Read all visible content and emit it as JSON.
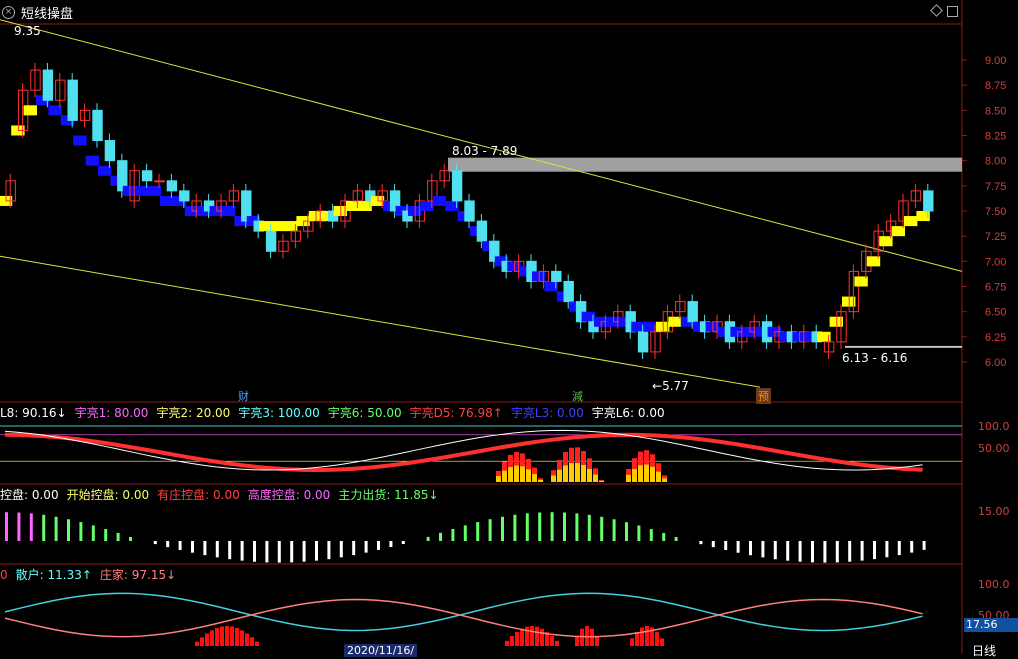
{
  "title": "短线操盘",
  "main_panel": {
    "high_label": "9.35",
    "range_upper_label": "8.03 - 7.89",
    "range_lower_label": "6.13 - 6.16",
    "low_label": "5.77",
    "y_ticks": [
      "9.00",
      "8.75",
      "8.50",
      "8.25",
      "8.00",
      "7.75",
      "7.50",
      "7.25",
      "7.00",
      "6.75",
      "6.50",
      "6.25",
      "6.00"
    ],
    "markers": [
      {
        "text": "财",
        "color": "#4ea0ff"
      },
      {
        "text": "減",
        "color": "#4ec04e"
      },
      {
        "text": "预",
        "color": "#ff8c00",
        "bg": "#6b3a1a"
      }
    ]
  },
  "panel2": {
    "items": [
      {
        "text": "L8: 90.16↓",
        "color": "#ffffff"
      },
      {
        "text": "宇亮1: 80.00",
        "color": "#ff66ff"
      },
      {
        "text": "宇亮2: 20.00",
        "color": "#ffff66"
      },
      {
        "text": "宇亮3: 100.00",
        "color": "#66ffff"
      },
      {
        "text": "宇亮6: 50.00",
        "color": "#66ff66"
      },
      {
        "text": "宇亮D5: 76.98↑",
        "color": "#ff4040"
      },
      {
        "text": "宇亮L3: 0.00",
        "color": "#4040ff"
      },
      {
        "text": "宇亮L6: 0.00",
        "color": "#ffffff"
      }
    ],
    "y_ticks": [
      "100.0",
      "50.00"
    ]
  },
  "panel3": {
    "items": [
      {
        "text": "控盘: 0.00",
        "color": "#ffffff"
      },
      {
        "text": "开始控盘: 0.00",
        "color": "#ffff66"
      },
      {
        "text": "有庄控盘: 0.00",
        "color": "#ff4040"
      },
      {
        "text": "高度控盘: 0.00",
        "color": "#ff66ff"
      },
      {
        "text": "主力出货: 11.85↓",
        "color": "#66ff66"
      }
    ],
    "y_ticks": [
      "15.00"
    ]
  },
  "panel4": {
    "items": [
      {
        "text": "0",
        "color": "#ff4040"
      },
      {
        "text": "散户: 11.33↑",
        "color": "#66ffff"
      },
      {
        "text": "庄家: 97.15↓",
        "color": "#ff8080"
      }
    ],
    "y_ticks": [
      "100.0",
      "50.00"
    ],
    "price_tag": "17.56"
  },
  "date_label": "2020/11/16/",
  "period_label": "日线",
  "colors": {
    "up": "#ff3030",
    "down": "#50e0f0",
    "trendline": "#e0e040",
    "band_yellow": "#ffff00",
    "band_blue": "#1010ff"
  },
  "chart_data": {
    "type": "candlestick",
    "ylim": [
      5.77,
      9.35
    ],
    "trendline_upper": [
      9.35,
      6.9
    ],
    "trendline_lower": [
      7.05,
      5.75
    ],
    "resistance_band": [
      8.03,
      7.89
    ],
    "support_line": 6.15,
    "closes": [
      7.8,
      8.7,
      8.9,
      8.6,
      8.8,
      8.4,
      8.5,
      8.2,
      8.0,
      7.7,
      7.9,
      7.8,
      7.8,
      7.7,
      7.6,
      7.6,
      7.5,
      7.6,
      7.7,
      7.4,
      7.3,
      7.1,
      7.2,
      7.3,
      7.4,
      7.5,
      7.4,
      7.6,
      7.7,
      7.6,
      7.7,
      7.5,
      7.4,
      7.6,
      7.8,
      7.9,
      7.6,
      7.4,
      7.2,
      7.0,
      6.9,
      7.0,
      6.8,
      6.9,
      6.8,
      6.6,
      6.4,
      6.3,
      6.4,
      6.5,
      6.3,
      6.1,
      6.3,
      6.5,
      6.6,
      6.4,
      6.3,
      6.4,
      6.2,
      6.3,
      6.4,
      6.2,
      6.3,
      6.2,
      6.3,
      6.2,
      6.2,
      6.5,
      6.9,
      7.1,
      7.3,
      7.4,
      7.6,
      7.7,
      7.5
    ],
    "opens": [
      7.6,
      8.3,
      8.7,
      8.9,
      8.6,
      8.8,
      8.4,
      8.5,
      8.2,
      8.0,
      7.6,
      7.9,
      7.8,
      7.8,
      7.7,
      7.5,
      7.6,
      7.5,
      7.6,
      7.7,
      7.4,
      7.3,
      7.1,
      7.2,
      7.3,
      7.4,
      7.5,
      7.4,
      7.6,
      7.7,
      7.6,
      7.7,
      7.5,
      7.4,
      7.6,
      7.8,
      7.9,
      7.6,
      7.4,
      7.2,
      7.0,
      6.9,
      7.0,
      6.8,
      6.9,
      6.8,
      6.6,
      6.4,
      6.3,
      6.4,
      6.5,
      6.3,
      6.1,
      6.3,
      6.5,
      6.6,
      6.4,
      6.3,
      6.4,
      6.2,
      6.3,
      6.4,
      6.2,
      6.3,
      6.2,
      6.3,
      6.1,
      6.2,
      6.5,
      6.9,
      7.1,
      7.3,
      7.4,
      7.6,
      7.7
    ],
    "band_values": [
      7.6,
      8.3,
      8.5,
      8.6,
      8.5,
      8.4,
      8.2,
      8.0,
      7.9,
      7.8,
      7.7,
      7.7,
      7.7,
      7.6,
      7.6,
      7.5,
      7.5,
      7.5,
      7.5,
      7.4,
      7.4,
      7.35,
      7.35,
      7.35,
      7.4,
      7.45,
      7.45,
      7.5,
      7.55,
      7.55,
      7.6,
      7.55,
      7.5,
      7.5,
      7.55,
      7.6,
      7.55,
      7.45,
      7.3,
      7.15,
      7.0,
      6.95,
      6.9,
      6.85,
      6.75,
      6.65,
      6.55,
      6.45,
      6.4,
      6.4,
      6.4,
      6.35,
      6.35,
      6.35,
      6.4,
      6.4,
      6.35,
      6.35,
      6.3,
      6.3,
      6.3,
      6.3,
      6.3,
      6.25,
      6.25,
      6.25,
      6.25,
      6.4,
      6.6,
      6.8,
      7.0,
      7.2,
      7.3,
      7.4,
      7.45
    ],
    "band_up": [
      1,
      1,
      1,
      0,
      0,
      0,
      0,
      0,
      0,
      0,
      0,
      0,
      0,
      0,
      0,
      0,
      0,
      0,
      0,
      0,
      0,
      1,
      1,
      1,
      1,
      1,
      1,
      1,
      1,
      1,
      1,
      0,
      0,
      0,
      0,
      0,
      0,
      0,
      0,
      0,
      0,
      0,
      0,
      0,
      0,
      0,
      0,
      0,
      0,
      0,
      0,
      0,
      0,
      1,
      1,
      0,
      0,
      0,
      0,
      0,
      0,
      0,
      0,
      0,
      0,
      0,
      1,
      1,
      1,
      1,
      1,
      1,
      1,
      1,
      1
    ]
  }
}
